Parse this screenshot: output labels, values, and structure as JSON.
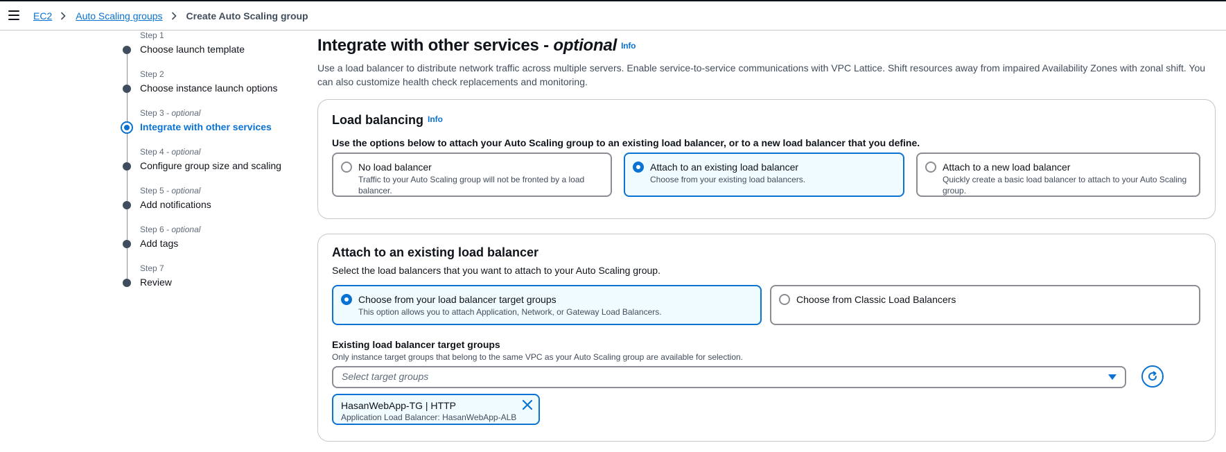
{
  "header": {
    "breadcrumbs": [
      "EC2",
      "Auto Scaling groups"
    ],
    "current": "Create Auto Scaling group"
  },
  "steps": [
    {
      "num": "Step 1",
      "optional": "",
      "title": "Choose launch template"
    },
    {
      "num": "Step 2",
      "optional": "",
      "title": "Choose instance launch options"
    },
    {
      "num": "Step 3",
      "optional": " - optional",
      "title": "Integrate with other services"
    },
    {
      "num": "Step 4",
      "optional": " - optional",
      "title": "Configure group size and scaling"
    },
    {
      "num": "Step 5",
      "optional": " - optional",
      "title": "Add notifications"
    },
    {
      "num": "Step 6",
      "optional": " - optional",
      "title": "Add tags"
    },
    {
      "num": "Step 7",
      "optional": "",
      "title": "Review"
    }
  ],
  "page": {
    "title": "Integrate with other services - ",
    "title_optional": "optional",
    "info": "Info",
    "description": "Use a load balancer to distribute network traffic across multiple servers. Enable service-to-service communications with VPC Lattice. Shift resources away from impaired Availability Zones with zonal shift. You can also customize health check replacements and monitoring."
  },
  "load_balancing": {
    "title": "Load balancing",
    "info": "Info",
    "instruction": "Use the options below to attach your Auto Scaling group to an existing load balancer, or to a new load balancer that you define.",
    "options": [
      {
        "label": "No load balancer",
        "desc": "Traffic to your Auto Scaling group will not be fronted by a load balancer.",
        "selected": false
      },
      {
        "label": "Attach to an existing load balancer",
        "desc": "Choose from your existing load balancers.",
        "selected": true
      },
      {
        "label": "Attach to a new load balancer",
        "desc": "Quickly create a basic load balancer to attach to your Auto Scaling group.",
        "selected": false
      }
    ]
  },
  "existing_lb": {
    "title": "Attach to an existing load balancer",
    "subtitle": "Select the load balancers that you want to attach to your Auto Scaling group.",
    "options": [
      {
        "label": "Choose from your load balancer target groups",
        "desc": "This option allows you to attach Application, Network, or Gateway Load Balancers.",
        "selected": true
      },
      {
        "label": "Choose from Classic Load Balancers",
        "desc": "",
        "selected": false
      }
    ],
    "field_label": "Existing load balancer target groups",
    "field_desc": "Only instance target groups that belong to the same VPC as your Auto Scaling group are available for selection.",
    "select_placeholder": "Select target groups",
    "token": {
      "title": "HasanWebApp-TG | HTTP",
      "sub": "Application Load Balancer: HasanWebApp-ALB"
    }
  },
  "colors": {
    "accent": "#0972d3",
    "selected_bg": "#f0fbff",
    "border": "#8c8c94"
  }
}
